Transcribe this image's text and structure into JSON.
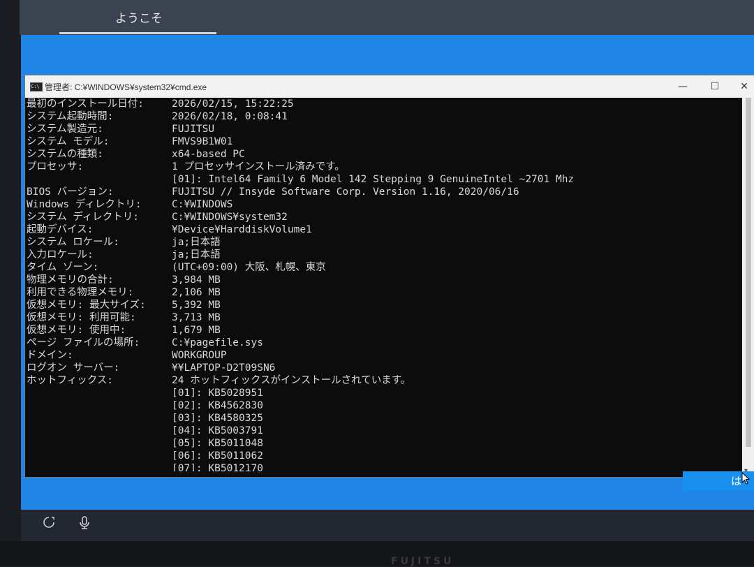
{
  "oobe": {
    "tab_label": "ようこそ"
  },
  "cmd": {
    "title": "管理者: C:¥WINDOWS¥system32¥cmd.exe",
    "minimize": "—",
    "maximize": "☐",
    "close": "✕",
    "rows": [
      {
        "label": "最初のインストール日付:",
        "value": "2026/02/15, 15:22:25"
      },
      {
        "label": "システム起動時間:",
        "value": "2026/02/18, 0:08:41"
      },
      {
        "label": "システム製造元:",
        "value": "FUJITSU"
      },
      {
        "label": "システム モデル:",
        "value": "FMVS9B1W01"
      },
      {
        "label": "システムの種類:",
        "value": "x64-based PC"
      },
      {
        "label": "プロセッサ:",
        "value": "1 プロセッサインストール済みです。"
      },
      {
        "label": "",
        "value": "[01]: Intel64 Family 6 Model 142 Stepping 9 GenuineIntel ~2701 Mhz"
      },
      {
        "label": "BIOS バージョン:",
        "value": "FUJITSU // Insyde Software Corp. Version 1.16, 2020/06/16"
      },
      {
        "label": "Windows ディレクトリ:",
        "value": "C:¥WINDOWS"
      },
      {
        "label": "システム ディレクトリ:",
        "value": "C:¥WINDOWS¥system32"
      },
      {
        "label": "起動デバイス:",
        "value": "¥Device¥HarddiskVolume1"
      },
      {
        "label": "システム ロケール:",
        "value": "ja;日本語"
      },
      {
        "label": "入力ロケール:",
        "value": "ja;日本語"
      },
      {
        "label": "タイム ゾーン:",
        "value": "(UTC+09:00) 大阪、札幌、東京"
      },
      {
        "label": "物理メモリの合計:",
        "value": "3,984 MB"
      },
      {
        "label": "利用できる物理メモリ:",
        "value": "2,106 MB"
      },
      {
        "label": "仮想メモリ: 最大サイズ:",
        "value": "5,392 MB"
      },
      {
        "label": "仮想メモリ: 利用可能:",
        "value": "3,713 MB"
      },
      {
        "label": "仮想メモリ: 使用中:",
        "value": "1,679 MB"
      },
      {
        "label": "ページ ファイルの場所:",
        "value": "C:¥pagefile.sys"
      },
      {
        "label": "ドメイン:",
        "value": "WORKGROUP"
      },
      {
        "label": "ログオン サーバー:",
        "value": "¥¥LAPTOP-D2T09SN6"
      },
      {
        "label": "ホットフィックス:",
        "value": "24 ホットフィックスがインストールされています。"
      },
      {
        "label": "",
        "value": "[01]: KB5028951"
      },
      {
        "label": "",
        "value": "[02]: KB4562830"
      },
      {
        "label": "",
        "value": "[03]: KB4580325"
      },
      {
        "label": "",
        "value": "[04]: KB5003791"
      },
      {
        "label": "",
        "value": "[05]: KB5011048"
      },
      {
        "label": "",
        "value": "[06]: KB5011062"
      },
      {
        "label": "",
        "value": "[07]: KB5012170"
      }
    ]
  },
  "ime": {
    "mode": "は"
  },
  "bezel": {
    "brand": "FUJITSU"
  },
  "colors": {
    "oobe_blue": "#1f86e6",
    "console_bg": "#0c0c0c",
    "console_text": "#d8d8d8"
  }
}
